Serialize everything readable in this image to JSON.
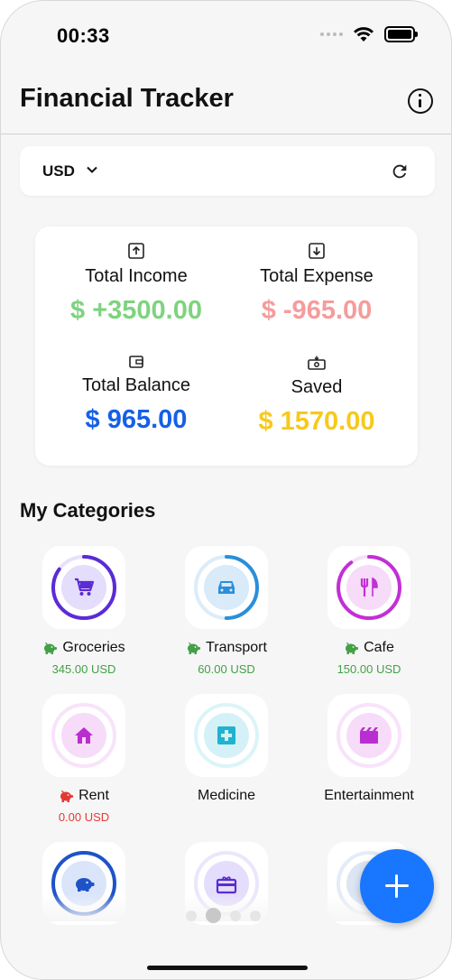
{
  "status_bar": {
    "time": "00:33"
  },
  "app_bar": {
    "title": "Financial Tracker"
  },
  "currency": {
    "selected": "USD"
  },
  "summary": {
    "income": {
      "label": "Total Income",
      "value": "$ +3500.00",
      "color": "#7ed37f"
    },
    "expense": {
      "label": "Total Expense",
      "value": "$ -965.00",
      "color": "#f59c9c"
    },
    "balance": {
      "label": "Total Balance",
      "value": "$ 965.00",
      "color": "#1560e8"
    },
    "saved": {
      "label": "Saved",
      "value": "$ 1570.00",
      "color": "#f7c91a"
    }
  },
  "categories_section": {
    "title": "My Categories"
  },
  "categories": [
    {
      "name": "Groceries",
      "amount": "345.00 USD",
      "icon": "cart-icon",
      "progress": 0.85,
      "color": "#5b2bd6"
    },
    {
      "name": "Transport",
      "amount": "60.00 USD",
      "icon": "car-icon",
      "progress": 0.5,
      "color": "#2a8fd8"
    },
    {
      "name": "Cafe",
      "amount": "150.00 USD",
      "icon": "restaurant-icon",
      "progress": 0.9,
      "color": "#c22fd6"
    },
    {
      "name": "Rent",
      "amount": "0.00 USD",
      "icon": "home-icon",
      "progress": 0,
      "color": "#b92ed0"
    },
    {
      "name": "Medicine",
      "amount": "",
      "icon": "medical-icon",
      "progress": 0,
      "color": "#1fb3cf"
    },
    {
      "name": "Entertainment",
      "amount": "",
      "icon": "movie-icon",
      "progress": 0,
      "color": "#b92ed0"
    }
  ],
  "colors": {
    "positive_amount": "#43a047",
    "zero_amount": "#e53935",
    "fab": "#1976ff"
  }
}
